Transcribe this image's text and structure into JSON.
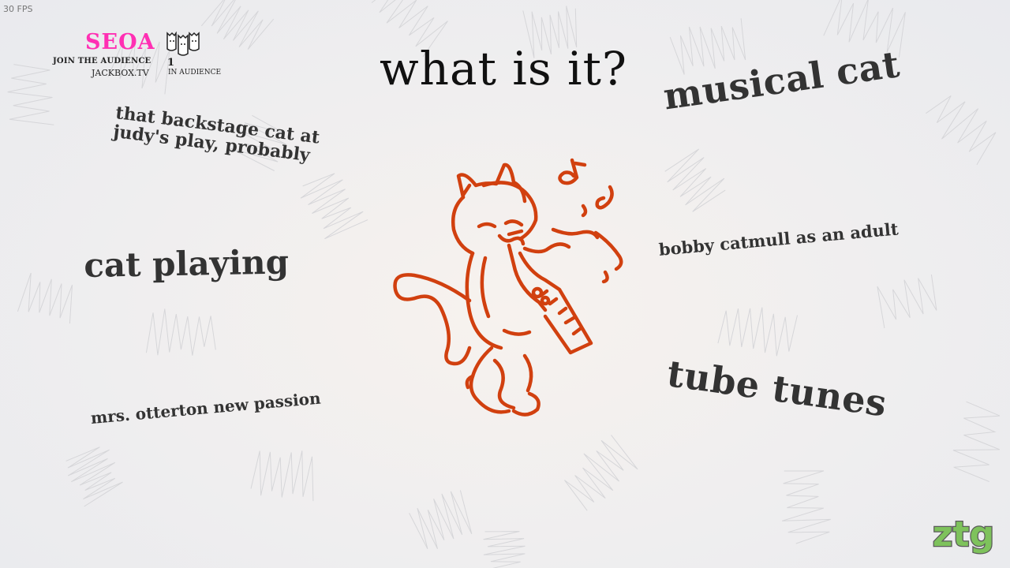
{
  "fps": "30 FPS",
  "header": {
    "room_code": "SEOA",
    "join_text": "JOIN THE AUDIENCE",
    "site": "JACKBOX.TV",
    "audience_count": "1",
    "audience_label": "IN AUDIENCE",
    "audience_icon": "audience-faces-icon"
  },
  "prompt": "what is it?",
  "answers": [
    {
      "line1": "that backstage cat at",
      "line2": "judy's play, probably"
    },
    {
      "text": "musical cat"
    },
    {
      "text": "cat playing"
    },
    {
      "text": "bobby catmull as an adult"
    },
    {
      "text": "mrs. otterton new passion"
    },
    {
      "text": "tube tunes"
    }
  ],
  "drawing": {
    "subject": "cat-playing-saxophone-drawing",
    "stroke_color": "#d1400f"
  },
  "logo": {
    "icon": "ztg-logo",
    "color": "#7ec25c"
  },
  "colors": {
    "room_code": "#ff2fb3",
    "answer_text": "#333333",
    "prompt_text": "#111111"
  }
}
